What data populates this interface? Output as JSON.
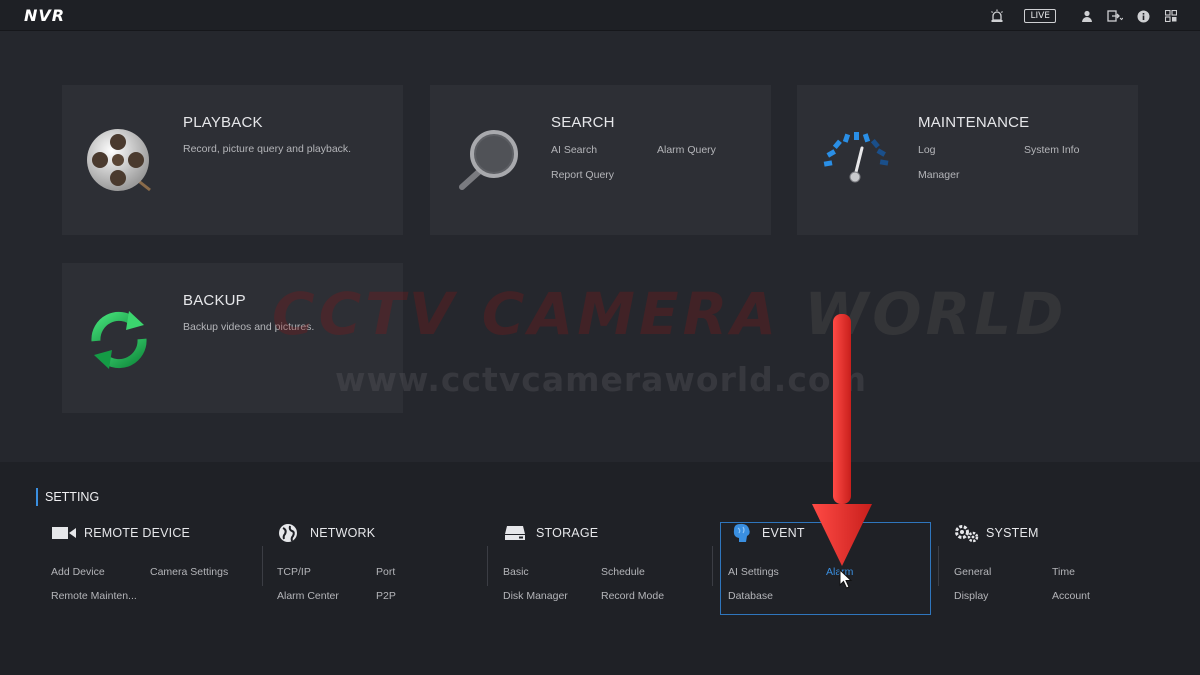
{
  "topbar": {
    "logo": "NVR",
    "live_label": "LIVE",
    "icons": [
      "alarm-icon",
      "user-icon",
      "logout-icon",
      "info-icon",
      "grid-icon"
    ]
  },
  "tiles": {
    "playback": {
      "title": "PLAYBACK",
      "desc": "Record, picture query and playback.",
      "icon": "film-reel-icon"
    },
    "search": {
      "title": "SEARCH",
      "links": [
        "AI Search",
        "Alarm Query",
        "Report Query"
      ],
      "icon": "magnifier-icon"
    },
    "maintenance": {
      "title": "MAINTENANCE",
      "links": [
        "Log",
        "System Info",
        "Manager"
      ],
      "icon": "gauge-icon"
    },
    "backup": {
      "title": "BACKUP",
      "desc": "Backup videos and pictures.",
      "icon": "sync-icon"
    }
  },
  "setting": {
    "title": "SETTING",
    "groups": {
      "remote_device": {
        "title": "REMOTE DEVICE",
        "links": [
          "Add Device",
          "Camera Settings",
          "Remote Mainten..."
        ],
        "icon": "camera-icon"
      },
      "network": {
        "title": "NETWORK",
        "links": [
          "TCP/IP",
          "Port",
          "Alarm Center",
          "P2P"
        ],
        "icon": "globe-icon"
      },
      "storage": {
        "title": "STORAGE",
        "links": [
          "Basic",
          "Schedule",
          "Disk Manager",
          "Record Mode"
        ],
        "icon": "hdd-icon"
      },
      "event": {
        "title": "EVENT",
        "links": [
          "AI Settings",
          "Alarm",
          "Database"
        ],
        "icon": "brain-icon"
      },
      "system": {
        "title": "SYSTEM",
        "links": [
          "General",
          "Time",
          "Display",
          "Account"
        ],
        "icon": "gears-icon"
      }
    }
  },
  "watermark": {
    "line1a": "CCTV CAMERA",
    "line1b": "WORLD",
    "line2": "www.cctvcameraworld.com"
  },
  "colors": {
    "accent": "#3a8fe0",
    "annotation_arrow": "#e8322e",
    "background": "#25272d",
    "tile": "#2d2f35",
    "setting_panel": "#1f2126"
  }
}
